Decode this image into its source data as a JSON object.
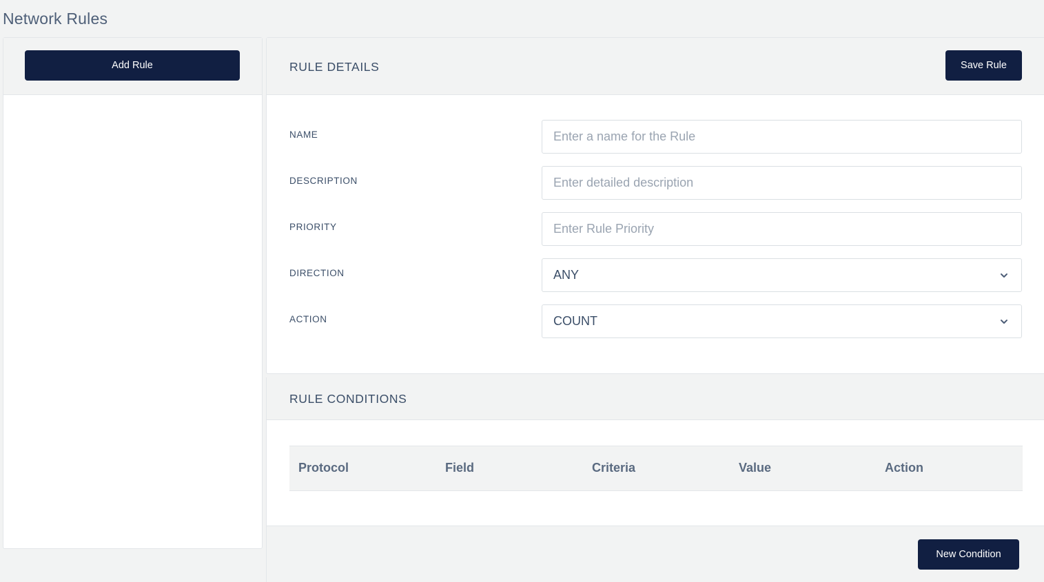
{
  "page": {
    "title": "Network Rules"
  },
  "left_panel": {
    "add_rule_label": "Add Rule"
  },
  "details": {
    "title": "RULE DETAILS",
    "save_label": "Save Rule",
    "fields": {
      "name": {
        "label": "NAME",
        "value": "",
        "placeholder": "Enter a name for the Rule"
      },
      "description": {
        "label": "DESCRIPTION",
        "value": "",
        "placeholder": "Enter detailed description"
      },
      "priority": {
        "label": "PRIORITY",
        "value": "",
        "placeholder": "Enter Rule Priority"
      },
      "direction": {
        "label": "DIRECTION",
        "selected": "ANY"
      },
      "action": {
        "label": "ACTION",
        "selected": "COUNT"
      }
    }
  },
  "conditions": {
    "title": "RULE CONDITIONS",
    "columns": [
      "Protocol",
      "Field",
      "Criteria",
      "Value",
      "Action"
    ],
    "rows": [],
    "new_condition_label": "New Condition"
  },
  "colors": {
    "primary_button": "#111f42",
    "background": "#f2f3f3",
    "heading_text": "#3b4e68"
  }
}
